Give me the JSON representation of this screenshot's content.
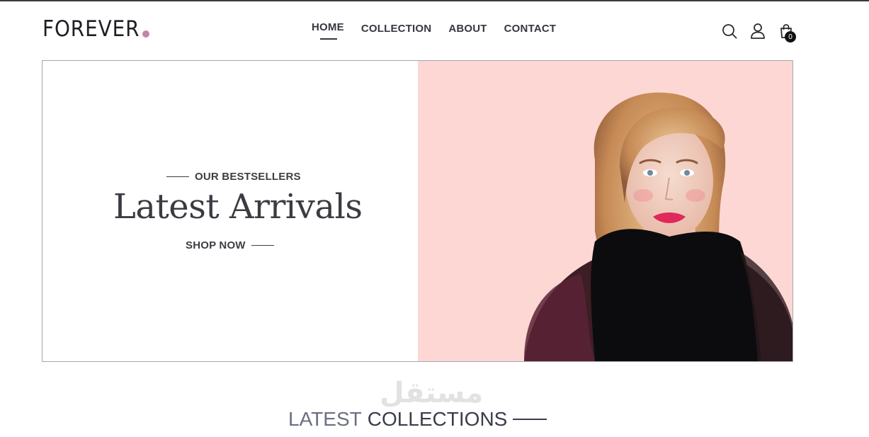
{
  "header": {
    "logo_text": "FOREVER",
    "nav": {
      "home": "HOME",
      "collection": "COLLECTION",
      "about": "ABOUT",
      "contact": "CONTACT"
    },
    "icons": [
      "search-icon",
      "user-icon",
      "cart-icon"
    ],
    "cart_count": "0"
  },
  "hero": {
    "eyebrow": "OUR BESTSELLERS",
    "headline": "Latest Arrivals",
    "cta": "SHOP NOW"
  },
  "section": {
    "title_light": "LATEST",
    "title_dark": "COLLECTIONS"
  },
  "watermark": "مستقل",
  "colors": {
    "logo_dot": "#c586a5",
    "hero_bg": "#fdd7d4",
    "text_dark": "#373743"
  }
}
